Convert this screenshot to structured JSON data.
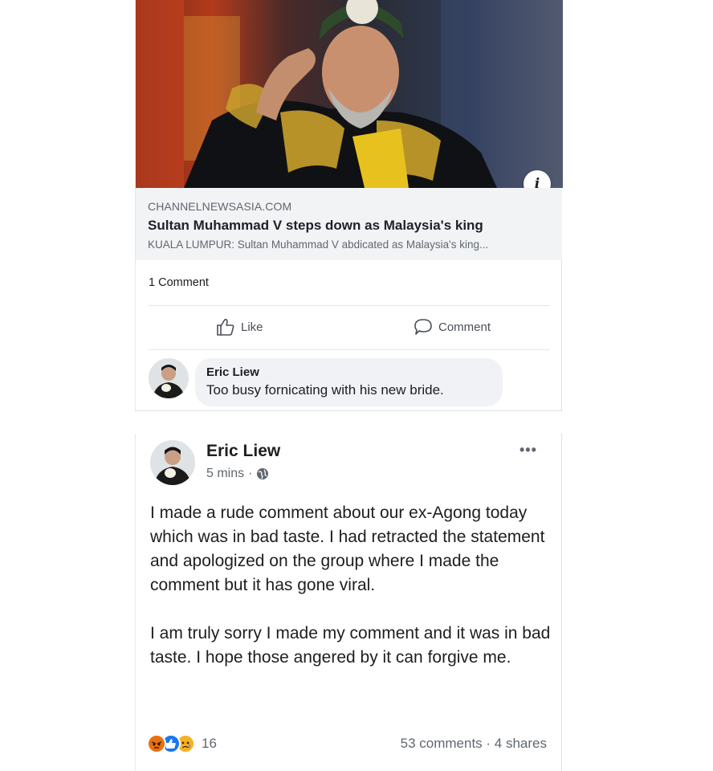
{
  "shared_link": {
    "domain": "CHANNELNEWSASIA.COM",
    "title": "Sultan Muhammad V steps down as Malaysia's king",
    "description": "KUALA LUMPUR: Sultan Muhammad V abdicated as Malaysia's king..."
  },
  "comment_count": "1 Comment",
  "actions": {
    "like_label": "Like",
    "comment_label": "Comment"
  },
  "comment": {
    "author": "Eric Liew",
    "text": "Too busy fornicating with his new bride."
  },
  "post": {
    "author": "Eric Liew",
    "time": "5 mins",
    "privacy_icon": "globe-icon",
    "more_icon": "•••",
    "paragraphs": [
      "I made a rude comment about our ex-Agong today which was in bad taste. I had retracted the statement and apologized on the group where I made the comment but it has gone viral.",
      "I am truly sorry I made my comment and it was in bad taste. I hope those angered by it can forgive me."
    ],
    "reaction_icons": [
      "angry-icon",
      "like-icon",
      "sad-icon"
    ],
    "reaction_count": "16",
    "comments_shares": "53 comments · 4 shares"
  },
  "colors": {
    "link_bg": "#f2f3f5",
    "bubble_bg": "#f0f2f5",
    "like_blue": "#1877f2",
    "angry_orange": "#e9710f",
    "sad_yellow": "#f7b125"
  }
}
